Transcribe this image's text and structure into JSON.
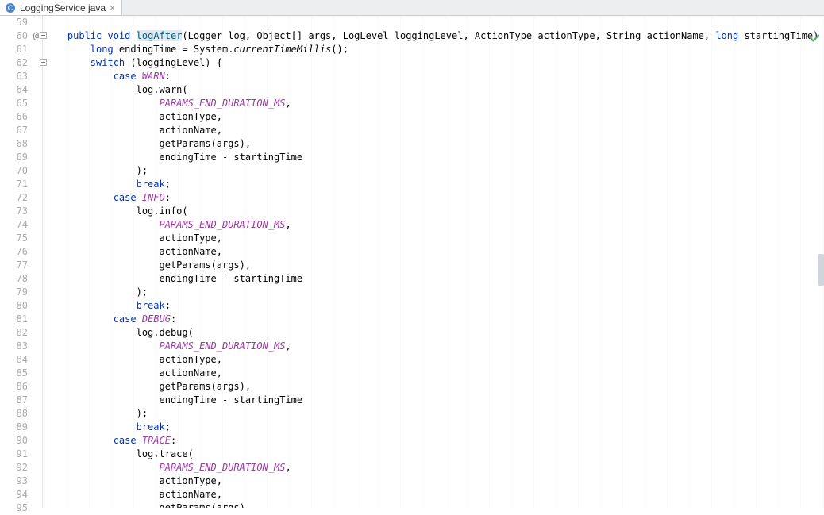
{
  "tab": {
    "filename": "LoggingService.java"
  },
  "lines": [
    {
      "n": 59,
      "html": ""
    },
    {
      "n": 60,
      "html": "    <span class='kw'>public</span> <span class='kw'>void</span> <span class='mname'>logAfter</span>(Logger log, Object[] args, LogLevel loggingLevel, ActionType actionType, String actionName, <span class='kw'>long</span> startingTime) { <span class='hl-end'> </span>"
    },
    {
      "n": 61,
      "html": "        <span class='kw'>long</span> endingTime = System.<span class='static-call'>currentTimeMillis</span>();"
    },
    {
      "n": 62,
      "html": "        <span class='kw'>switch</span> (loggingLevel) {"
    },
    {
      "n": 63,
      "html": "            <span class='kw'>case</span> <span class='enum'>WARN</span>:"
    },
    {
      "n": 64,
      "html": "                log.warn("
    },
    {
      "n": 65,
      "html": "                    <span class='field-italic'>PARAMS_END_DURATION_MS</span>,"
    },
    {
      "n": 66,
      "html": "                    actionType,"
    },
    {
      "n": 67,
      "html": "                    actionName,"
    },
    {
      "n": 68,
      "html": "                    getParams(args),"
    },
    {
      "n": 69,
      "html": "                    endingTime - startingTime"
    },
    {
      "n": 70,
      "html": "                );"
    },
    {
      "n": 71,
      "html": "                <span class='kw'>break</span>;"
    },
    {
      "n": 72,
      "html": "            <span class='kw'>case</span> <span class='enum'>INFO</span>:"
    },
    {
      "n": 73,
      "html": "                log.info("
    },
    {
      "n": 74,
      "html": "                    <span class='field-italic'>PARAMS_END_DURATION_MS</span>,"
    },
    {
      "n": 75,
      "html": "                    actionType,"
    },
    {
      "n": 76,
      "html": "                    actionName,"
    },
    {
      "n": 77,
      "html": "                    getParams(args),"
    },
    {
      "n": 78,
      "html": "                    endingTime - startingTime"
    },
    {
      "n": 79,
      "html": "                );"
    },
    {
      "n": 80,
      "html": "                <span class='kw'>break</span>;"
    },
    {
      "n": 81,
      "html": "            <span class='kw'>case</span> <span class='enum'>DEBUG</span>:"
    },
    {
      "n": 82,
      "html": "                log.debug("
    },
    {
      "n": 83,
      "html": "                    <span class='field-italic'>PARAMS_END_DURATION_MS</span>,"
    },
    {
      "n": 84,
      "html": "                    actionType,"
    },
    {
      "n": 85,
      "html": "                    actionName,"
    },
    {
      "n": 86,
      "html": "                    getParams(args),"
    },
    {
      "n": 87,
      "html": "                    endingTime - startingTime"
    },
    {
      "n": 88,
      "html": "                );"
    },
    {
      "n": 89,
      "html": "                <span class='kw'>break</span>;"
    },
    {
      "n": 90,
      "html": "            <span class='kw'>case</span> <span class='enum'>TRACE</span>:"
    },
    {
      "n": 91,
      "html": "                log.trace("
    },
    {
      "n": 92,
      "html": "                    <span class='field-italic'>PARAMS_END_DURATION_MS</span>,"
    },
    {
      "n": 93,
      "html": "                    actionType,"
    },
    {
      "n": 94,
      "html": "                    actionName,"
    },
    {
      "n": 95,
      "html": "                    getParams(args)"
    }
  ]
}
